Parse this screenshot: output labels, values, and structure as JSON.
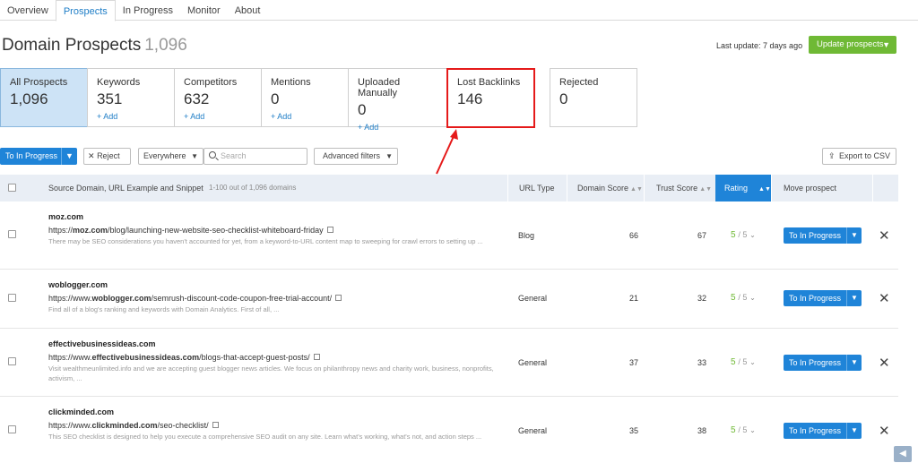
{
  "tabs": [
    "Overview",
    "Prospects",
    "In Progress",
    "Monitor",
    "About"
  ],
  "header": {
    "title": "Domain Prospects",
    "count": "1,096",
    "last_update": "Last update: 7 days ago",
    "update_button": "Update prospects"
  },
  "cards": [
    {
      "label": "All Prospects",
      "value": "1,096",
      "add": ""
    },
    {
      "label": "Keywords",
      "value": "351",
      "add": "+ Add"
    },
    {
      "label": "Competitors",
      "value": "632",
      "add": "+ Add"
    },
    {
      "label": "Mentions",
      "value": "0",
      "add": "+ Add"
    },
    {
      "label": "Uploaded Manually",
      "value": "0",
      "add": "+ Add"
    },
    {
      "label": "Lost Backlinks",
      "value": "146",
      "add": ""
    },
    {
      "label": "Rejected",
      "value": "0",
      "add": ""
    }
  ],
  "toolbar": {
    "to_progress": "To In Progress",
    "reject": "Reject",
    "scope": "Everywhere",
    "search_placeholder": "Search",
    "advanced": "Advanced filters",
    "export": "Export to CSV"
  },
  "table": {
    "columns": {
      "source": "Source Domain, URL Example and Snippet",
      "range": "1-100 out of 1,096 domains",
      "url_type": "URL Type",
      "domain_score": "Domain Score",
      "trust_score": "Trust Score",
      "rating": "Rating",
      "move": "Move prospect"
    },
    "rows": [
      {
        "domain": "moz.com",
        "url_prefix": "https://",
        "url_bold": "moz.com",
        "url_rest": "/blog/launching-new-website-seo-checklist-whiteboard-friday",
        "snippet": "There may be SEO considerations you haven't accounted for yet, from a keyword-to-URL content map to sweeping for crawl errors to setting up ...",
        "type": "Blog",
        "domain_score": "66",
        "trust_score": "67",
        "rating": "5",
        "rating_den": "/ 5",
        "action": "To In Progress"
      },
      {
        "domain": "woblogger.com",
        "url_prefix": "https://www.",
        "url_bold": "woblogger.com",
        "url_rest": "/semrush-discount-code-coupon-free-trial-account/",
        "snippet": "Find all of a blog's ranking and keywords with Domain Analytics. First of all, ...",
        "type": "General",
        "domain_score": "21",
        "trust_score": "32",
        "rating": "5",
        "rating_den": "/ 5",
        "action": "To In Progress"
      },
      {
        "domain": "effectivebusinessideas.com",
        "url_prefix": "https://www.",
        "url_bold": "effectivebusinessideas.com",
        "url_rest": "/blogs-that-accept-guest-posts/",
        "snippet": "Visit wealthmeunlimited.info and we are accepting guest blogger news articles. We focus on philanthropy news and charity work, business, nonprofits, activism, ...",
        "type": "General",
        "domain_score": "37",
        "trust_score": "33",
        "rating": "5",
        "rating_den": "/ 5",
        "action": "To In Progress"
      },
      {
        "domain": "clickminded.com",
        "url_prefix": "https://www.",
        "url_bold": "clickminded.com",
        "url_rest": "/seo-checklist/",
        "snippet": "This SEO checklist is designed to help you execute a comprehensive SEO audit on any site. Learn what's working, what's not, and action steps ...",
        "type": "General",
        "domain_score": "35",
        "trust_score": "38",
        "rating": "5",
        "rating_den": "/ 5",
        "action": "To In Progress"
      }
    ]
  },
  "colors": {
    "accent": "#1f84d8",
    "green": "#6fb935",
    "highlight": "#e51a1a",
    "active_card": "#cde3f6"
  }
}
